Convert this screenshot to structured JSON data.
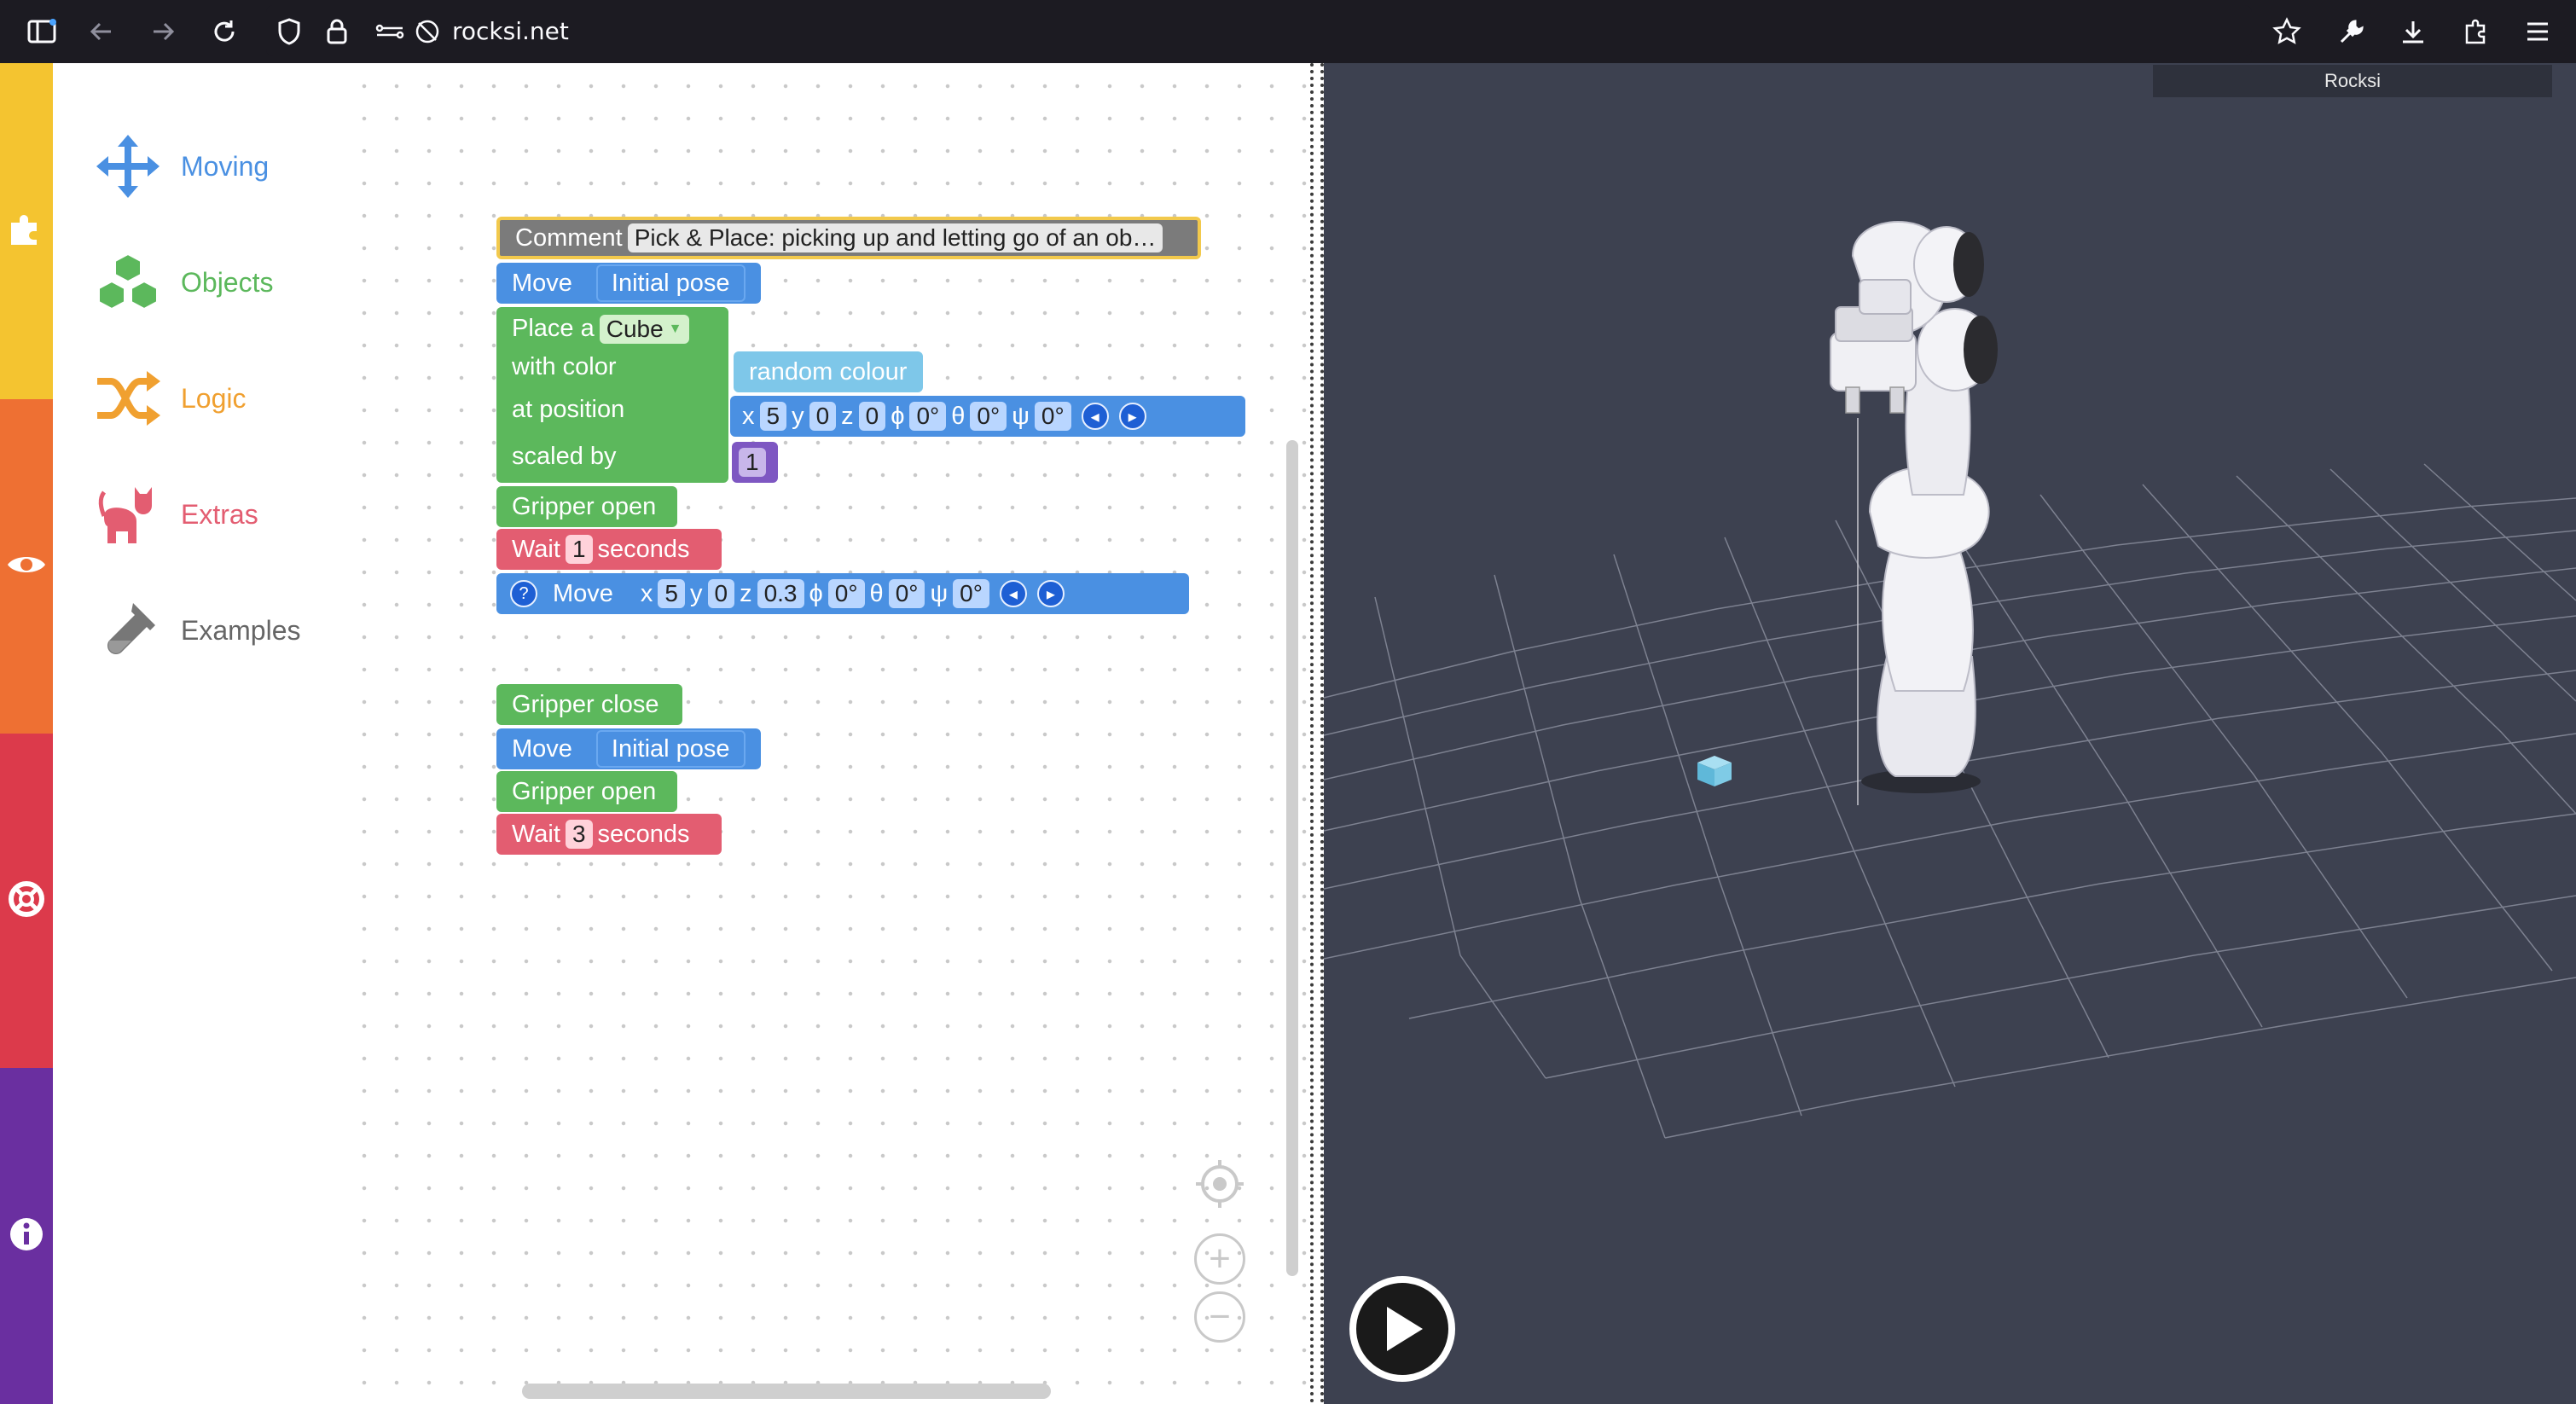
{
  "browser": {
    "url": "rocksi.net"
  },
  "toolbox": {
    "categories": [
      {
        "label": "Moving",
        "color": "#4a90e2",
        "icon": "move-arrows-icon"
      },
      {
        "label": "Objects",
        "color": "#5cb85c",
        "icon": "cubes-icon"
      },
      {
        "label": "Logic",
        "color": "#f0a030",
        "icon": "shuffle-icon"
      },
      {
        "label": "Extras",
        "color": "#e35d71",
        "icon": "cat-icon"
      },
      {
        "label": "Examples",
        "color": "#666666",
        "icon": "test-tube-icon"
      }
    ]
  },
  "strip": {
    "colors": [
      "#f4c430",
      "#ee7033",
      "#dc3a4b",
      "#6a2fa0"
    ],
    "icons": [
      "puzzle-icon",
      "eye-icon",
      "lifebuoy-icon",
      "info-icon"
    ]
  },
  "blocks": {
    "comment": {
      "label": "Comment",
      "text": "Pick & Place: picking up and letting go of an ob…"
    },
    "move1": {
      "label": "Move",
      "pose": "Initial pose"
    },
    "place": {
      "label": "Place a",
      "object": "Cube",
      "with_color": "with color",
      "color_value": "random colour",
      "at_position": "at position",
      "scaled_by": "scaled by",
      "scale": "1"
    },
    "pos1": {
      "x_lbl": "x",
      "x": "5",
      "y_lbl": "y",
      "y": "0",
      "z_lbl": "z",
      "z": "0",
      "phi_lbl": "ϕ",
      "phi": "0°",
      "theta_lbl": "θ",
      "theta": "0°",
      "psi_lbl": "ψ",
      "psi": "0°"
    },
    "gripper_open1": {
      "label": "Gripper open"
    },
    "wait1": {
      "label": "Wait",
      "value": "1",
      "unit": "seconds"
    },
    "move2": {
      "label": "Move",
      "help": "?"
    },
    "pos2": {
      "x_lbl": "x",
      "x": "5",
      "y_lbl": "y",
      "y": "0",
      "z_lbl": "z",
      "z": "0.3",
      "phi_lbl": "ϕ",
      "phi": "0°",
      "theta_lbl": "θ",
      "theta": "0°",
      "psi_lbl": "ψ",
      "psi": "0°"
    },
    "gripper_close": {
      "label": "Gripper close"
    },
    "move3": {
      "label": "Move",
      "pose": "Initial pose"
    },
    "gripper_open2": {
      "label": "Gripper open"
    },
    "wait2": {
      "label": "Wait",
      "value": "3",
      "unit": "seconds"
    }
  },
  "viewer": {
    "title": "Rocksi"
  }
}
